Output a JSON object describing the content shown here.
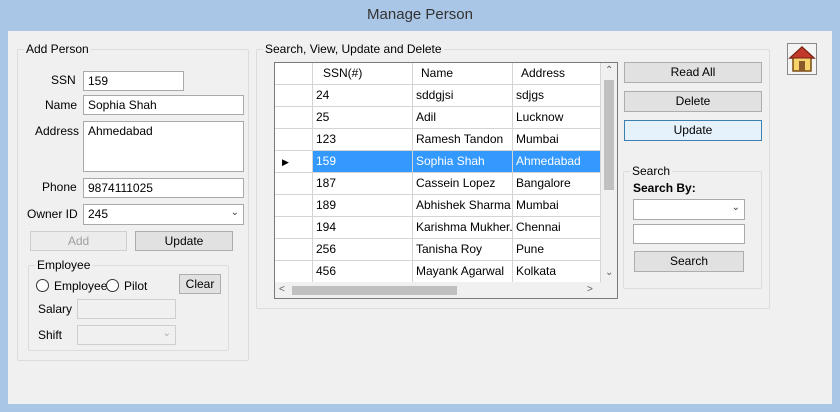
{
  "window": {
    "title": "Manage Person"
  },
  "add_person": {
    "group_title": "Add Person",
    "ssn_label": "SSN",
    "ssn_value": "159",
    "name_label": "Name",
    "name_value": "Sophia Shah",
    "address_label": "Address",
    "address_value": "Ahmedabad",
    "phone_label": "Phone",
    "phone_value": "9874111025",
    "owner_label": "Owner ID",
    "owner_value": "245",
    "add_label": "Add",
    "update_label": "Update"
  },
  "employee": {
    "group_title": "Employee",
    "radio_employee": "Employee",
    "radio_pilot": "Pilot",
    "clear_label": "Clear",
    "salary_label": "Salary",
    "salary_value": "",
    "shift_label": "Shift",
    "shift_value": ""
  },
  "grid_section": {
    "group_title": "Search, View, Update and Delete",
    "columns": [
      "SSN(#)",
      "Name",
      "Address"
    ],
    "rows": [
      [
        "24",
        "sddgjsi",
        "sdjgs"
      ],
      [
        "25",
        "Adil",
        "Lucknow"
      ],
      [
        "123",
        "Ramesh Tandon",
        "Mumbai"
      ],
      [
        "159",
        "Sophia Shah",
        "Ahmedabad"
      ],
      [
        "187",
        "Cassein Lopez",
        "Bangalore"
      ],
      [
        "189",
        "Abhishek Sharma",
        "Mumbai"
      ],
      [
        "194",
        "Karishma Mukher...",
        "Chennai"
      ],
      [
        "256",
        "Tanisha Roy",
        "Pune"
      ],
      [
        "456",
        "Mayank Agarwal",
        "Kolkata"
      ]
    ],
    "selected_row": 3
  },
  "actions": {
    "read_all_label": "Read All",
    "delete_label": "Delete",
    "update_label": "Update"
  },
  "search": {
    "group_title": "Search",
    "search_by_label": "Search By:",
    "search_by_value": "",
    "query_value": "",
    "search_button_label": "Search"
  },
  "colors": {
    "selection": "#3399ff",
    "window_frame": "#aac6e6"
  },
  "icons": {
    "home": "home-icon"
  }
}
